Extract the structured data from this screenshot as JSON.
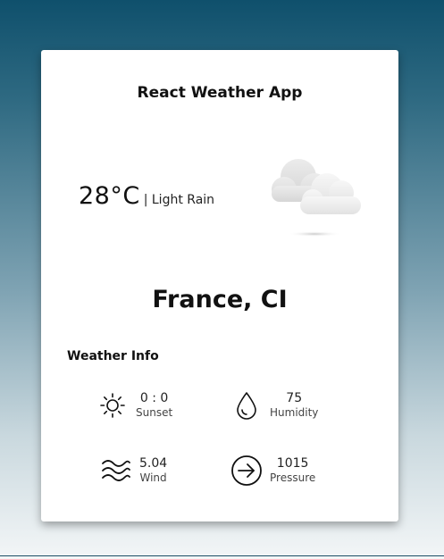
{
  "app": {
    "title": "React Weather App"
  },
  "current": {
    "temperature": "28°C",
    "description": "| Light Rain",
    "icon": "cloud-icon"
  },
  "location": {
    "city": "France, CI"
  },
  "weather_info": {
    "title": "Weather Info",
    "items": [
      {
        "value": "0 : 0",
        "label": "Sunset",
        "icon": "sun-icon"
      },
      {
        "value": "75",
        "label": "Humidity",
        "icon": "droplet-icon"
      },
      {
        "value": "5.04",
        "label": "Wind",
        "icon": "wind-icon"
      },
      {
        "value": "1015",
        "label": "Pressure",
        "icon": "pressure-arrow-icon"
      }
    ]
  },
  "colors": {
    "background_top": "#0f506c",
    "background_bottom": "#f3f6f7",
    "card": "#ffffff",
    "text": "#111111"
  }
}
